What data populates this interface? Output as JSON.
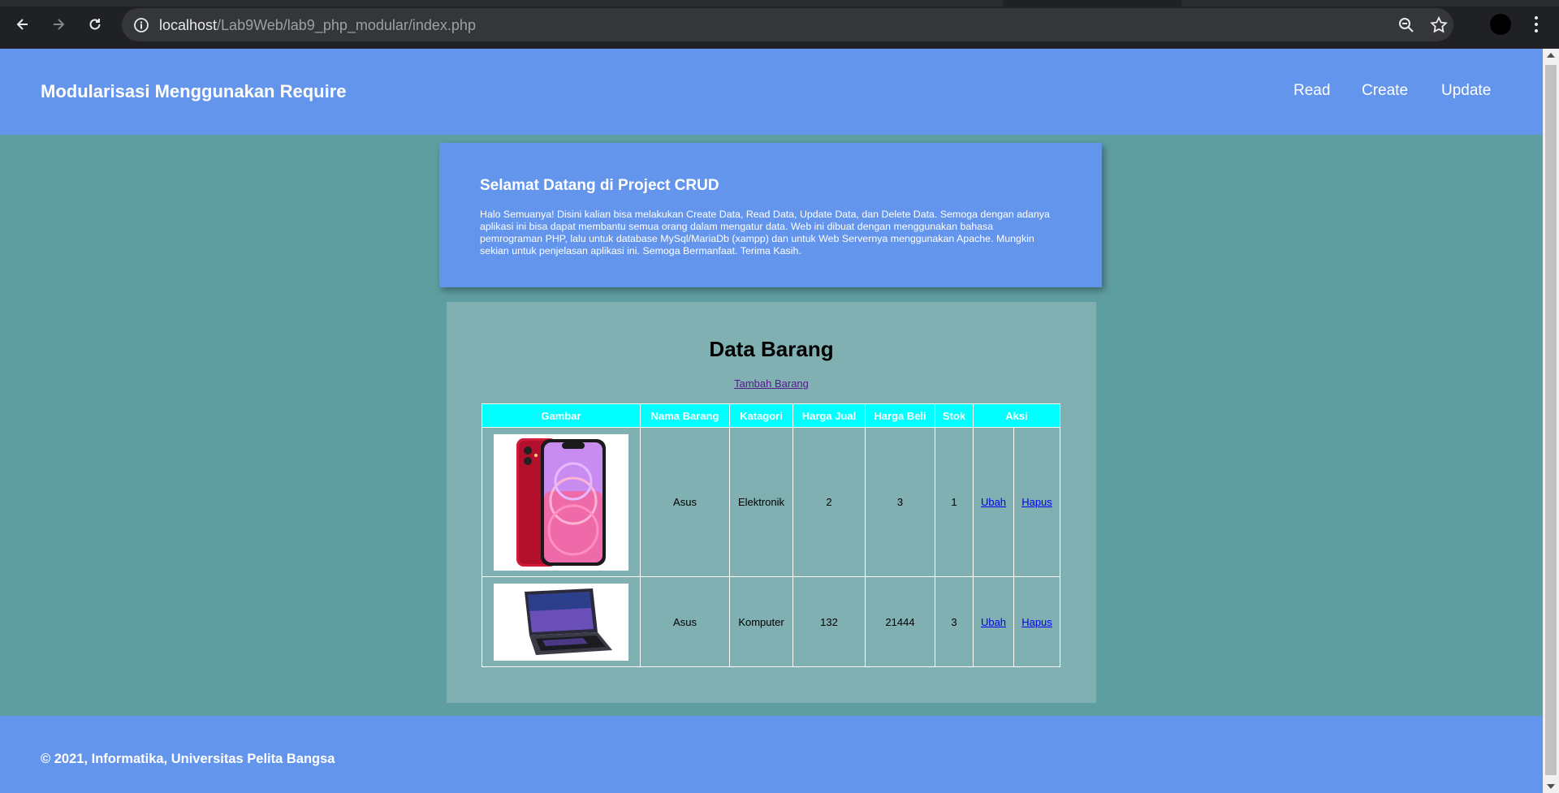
{
  "browser": {
    "url_host": "localhost",
    "url_path": "/Lab9Web/lab9_php_modular/index.php"
  },
  "site": {
    "brand": "Modularisasi Menggunakan Require",
    "nav": [
      {
        "label": "Read"
      },
      {
        "label": "Create"
      },
      {
        "label": "Update"
      }
    ]
  },
  "welcome": {
    "title": "Selamat Datang di Project CRUD",
    "text": "Halo Semuanya! Disini kalian bisa melakukan Create Data, Read Data, Update Data, dan Delete Data. Semoga dengan adanya aplikasi ini bisa dapat membantu semua orang dalam mengatur data. Web ini dibuat dengan menggunakan bahasa pemrograman PHP, lalu untuk database MySql/MariaDb (xampp) dan untuk Web Servernya menggunakan Apache. Mungkin sekian untuk penjelasan aplikasi ini. Semoga Bermanfaat. Terima Kasih."
  },
  "content": {
    "title": "Data Barang",
    "add_link": "Tambah Barang",
    "table": {
      "headers": [
        "Gambar",
        "Nama Barang",
        "Katagori",
        "Harga Jual",
        "Harga Beli",
        "Stok",
        "Aksi"
      ],
      "rows": [
        {
          "image": "phone-image",
          "nama": "Asus",
          "kategori": "Elektronik",
          "harga_jual": "2",
          "harga_beli": "3",
          "stok": "1",
          "edit": "Ubah",
          "delete": "Hapus"
        },
        {
          "image": "laptop-image",
          "nama": "Asus",
          "kategori": "Komputer",
          "harga_jual": "132",
          "harga_beli": "21444",
          "stok": "3",
          "edit": "Ubah",
          "delete": "Hapus"
        }
      ]
    }
  },
  "footer": {
    "text": "© 2021, Informatika, Universitas Pelita Bangsa"
  },
  "colors": {
    "header_bg": "#6495ed",
    "page_bg": "#5f9ea0",
    "content_bg": "#80b0b2",
    "table_header_bg": "#00ffff"
  }
}
